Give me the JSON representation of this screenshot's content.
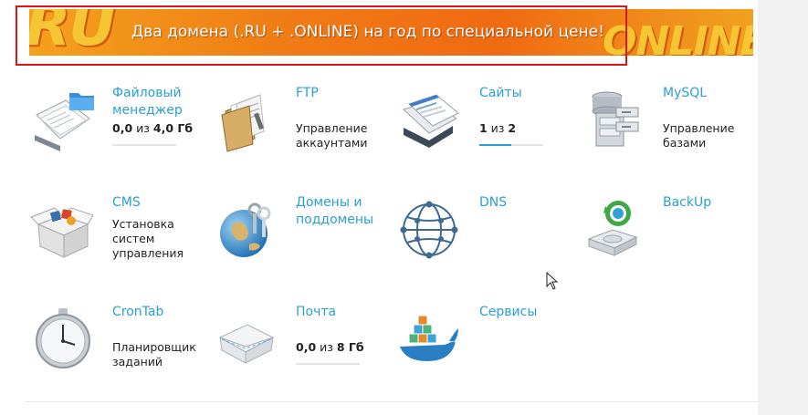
{
  "banner": {
    "left_logo": "RU",
    "text": "Два домена (.RU + .ONLINE) на год по специальной цене!",
    "right_logo": "ONLINE"
  },
  "tiles": [
    {
      "id": "file-manager",
      "title": "Файловый менеджер",
      "stat_a": "0,0",
      "stat_sep": " из ",
      "stat_b": "4,0 Гб",
      "progress": 0,
      "icon": "folder-documents-icon"
    },
    {
      "id": "ftp",
      "title": "FTP",
      "desc": "Управление аккаунтами",
      "icon": "ftp-folder-icon"
    },
    {
      "id": "sites",
      "title": "Сайты",
      "stat_a": "1",
      "stat_sep": " из ",
      "stat_b": "2",
      "progress": 0.5,
      "icon": "browser-windows-icon"
    },
    {
      "id": "mysql",
      "title": "MySQL",
      "desc": "Управление базами",
      "icon": "database-server-icon"
    },
    {
      "id": "cms",
      "title": "CMS",
      "desc": "Установка систем управления",
      "icon": "cms-box-icon"
    },
    {
      "id": "domains",
      "title": "Домены и поддомены",
      "icon": "globe-keys-icon"
    },
    {
      "id": "dns",
      "title": "DNS",
      "icon": "network-sphere-icon"
    },
    {
      "id": "backup",
      "title": "BackUp",
      "icon": "backup-drive-icon"
    },
    {
      "id": "crontab",
      "title": "CronTab",
      "desc": "Планировщик заданий",
      "icon": "clock-icon"
    },
    {
      "id": "mail",
      "title": "Почта",
      "stat_a": "0,0",
      "stat_sep": " из ",
      "stat_b": "8 Гб",
      "progress": 0,
      "icon": "envelope-icon"
    },
    {
      "id": "services",
      "title": "Сервисы",
      "icon": "whale-containers-icon"
    }
  ],
  "colors": {
    "accent": "#2a9fd6",
    "banner_orange": "#f07c15",
    "highlight_red": "#e0121a"
  }
}
